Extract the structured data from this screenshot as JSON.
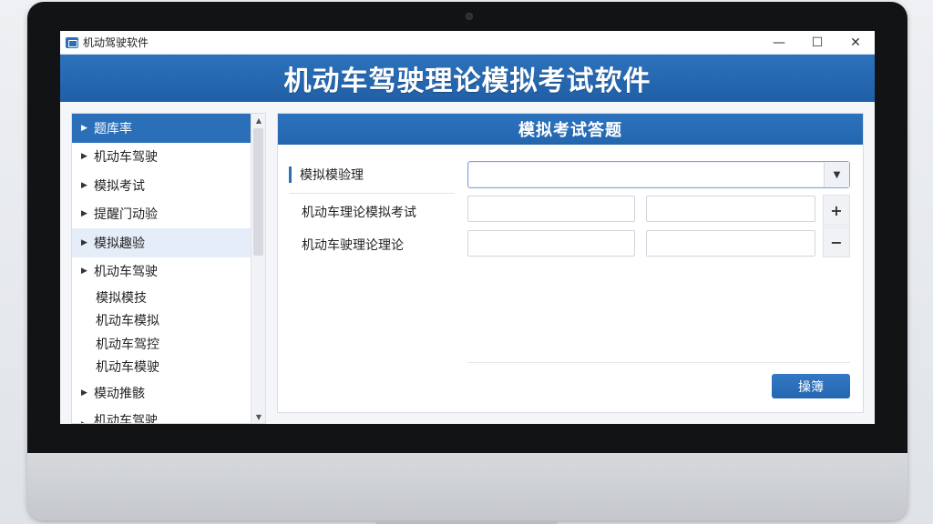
{
  "window": {
    "title": "机动驾驶软件",
    "controls": {
      "minimize": "—",
      "maximize": "☐",
      "close": "✕"
    }
  },
  "banner": {
    "title": "机动车驾驶理论模拟考试软件"
  },
  "sidebar": {
    "items": [
      {
        "label": "题库率",
        "arrow": "▶"
      },
      {
        "label": "机动车驾驶",
        "arrow": "▶"
      },
      {
        "label": "模拟考试",
        "arrow": "▶"
      },
      {
        "label": "提醒门动验",
        "arrow": "▶"
      },
      {
        "label": "模拟趣验",
        "arrow": "▶"
      },
      {
        "label": "机动车驾驶",
        "arrow": "▶"
      }
    ],
    "subitems": [
      "模拟模技",
      "机动车模拟",
      "机动车驾控",
      "机动车模驶"
    ],
    "tail_items": [
      {
        "label": "模动推骸",
        "arrow": "▶"
      },
      {
        "label": "机动车驾驶",
        "arrow": "▶"
      }
    ],
    "scroll": {
      "up": "▲",
      "down": "▼"
    }
  },
  "panel": {
    "title": "模拟考试答题",
    "field_label": "模拟模验理",
    "select_value": "",
    "select_arrow": "▼",
    "rows": [
      {
        "label": "机动车理论模拟考试"
      },
      {
        "label": "机动车驶理论理论"
      }
    ],
    "plus": "+",
    "minus": "−",
    "submit": "操簿"
  },
  "colors": {
    "accent": "#2a6fb8",
    "banner": "#2267b0",
    "bezel": "#121314"
  }
}
